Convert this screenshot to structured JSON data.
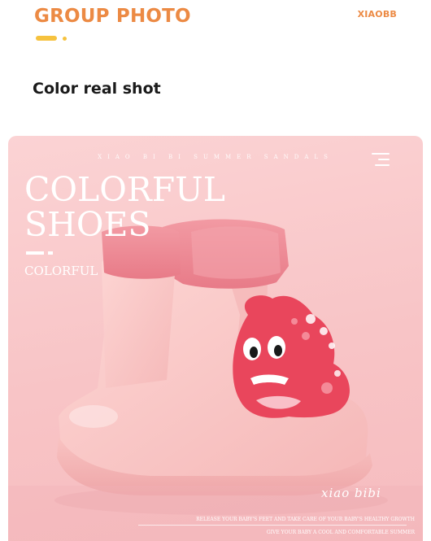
{
  "header": {
    "title": "GROUP PHOTO",
    "brand": "XIAOBB",
    "accent_color": "#ec8a44",
    "decor_color": "#f6c23e"
  },
  "section": {
    "heading": "Color real shot"
  },
  "photo": {
    "tagline": "XIAO BI BI SUMMER SANDALS",
    "menu_icon": "menu-icon",
    "title_line1": "COLORFUL",
    "title_line2": "SHOES",
    "subtitle": "COLORFUL",
    "logo": "xiao bibi",
    "caption_line1": "RELEASE YOUR BABY'S FEET AND TAKE CARE OF YOUR BABY'S HEALTHY GROWTH",
    "caption_line2": "GIVE YOUR BABY A COOL AND COMFORTABLE SUMMER",
    "product": "pink-rain-boot-with-dinosaur",
    "colors": {
      "background": "#f8c4c6",
      "boot": "#fbc6c6",
      "fleece": "#ec8a96",
      "dinosaur": "#e9465c"
    }
  }
}
